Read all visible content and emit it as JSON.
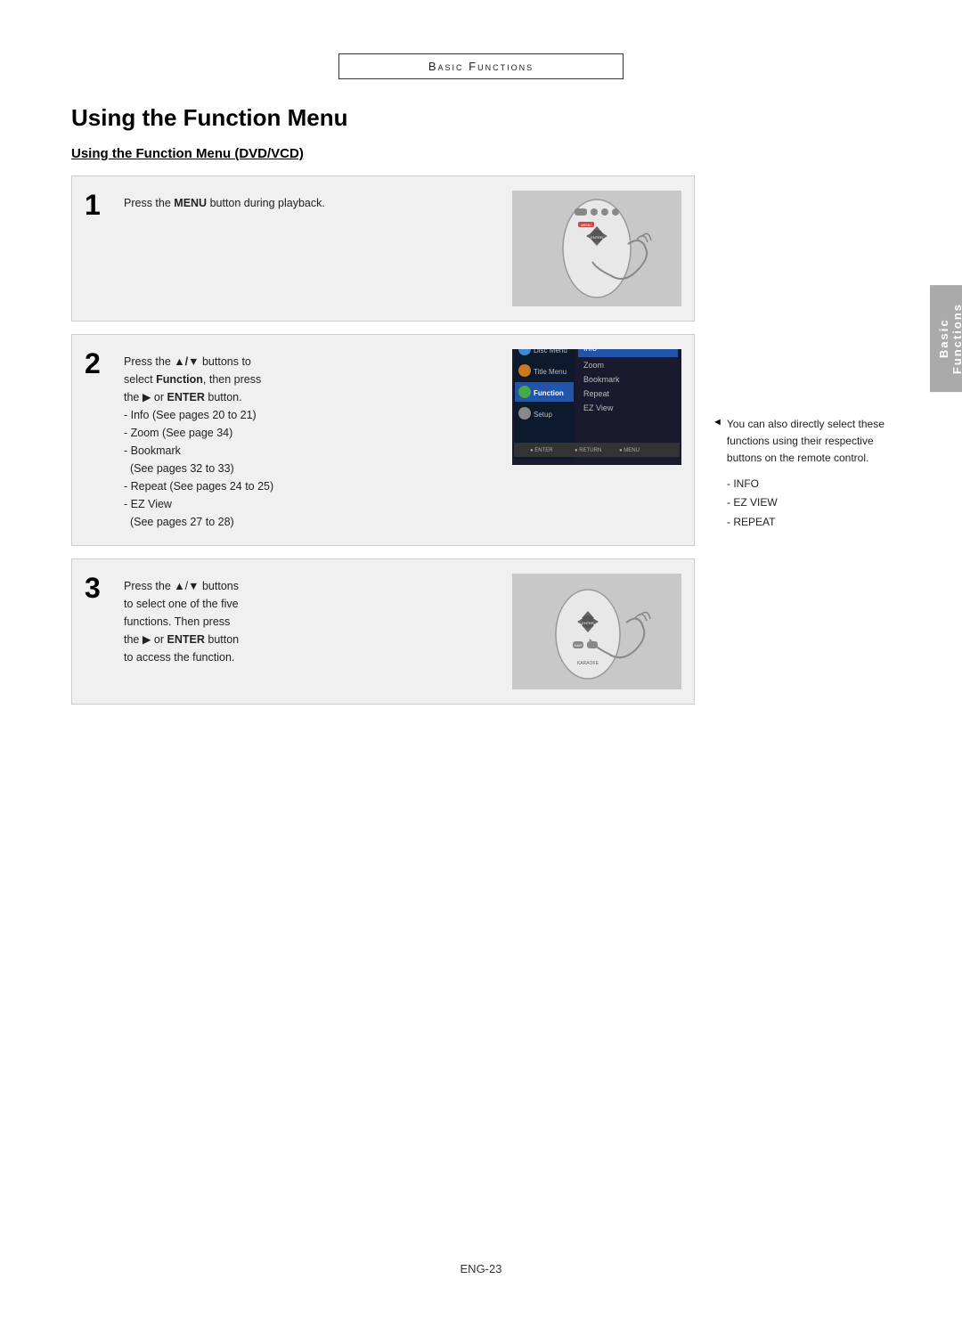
{
  "header": {
    "title": "Basic Functions"
  },
  "main_title": "Using the Function Menu",
  "section_heading": "Using the Function Menu (DVD/VCD)",
  "steps": [
    {
      "number": "1",
      "text_before_bold": "Press the ",
      "bold_text": "MENU",
      "text_after_bold": " button during playback.",
      "image_type": "remote_hand"
    },
    {
      "number": "2",
      "text_lines": [
        {
          "before": "Press the ",
          "bold": "▲/▼",
          "after": " buttons to"
        },
        {
          "before": "select ",
          "bold": "Function",
          "after": ", then press"
        },
        {
          "before": "the ▶ or ",
          "bold": "ENTER",
          "after": " button."
        },
        {
          "plain": "- Info (See pages 20 to 21)"
        },
        {
          "plain": "- Zoom (See page 34)"
        },
        {
          "plain": "- Bookmark"
        },
        {
          "plain": "  (See pages 32 to 33)"
        },
        {
          "plain": "- Repeat (See pages 24 to 25)"
        },
        {
          "plain": "- EZ View"
        },
        {
          "plain": "  (See pages 27 to 28)"
        }
      ],
      "image_type": "menu_screen",
      "menu_items": [
        "Info",
        "Zoom",
        "Bookmark",
        "Repeat",
        "EZ View"
      ],
      "menu_highlighted": "Info",
      "menu_sidebar": [
        "Disc Menu",
        "Title Menu",
        "Function",
        "Setup"
      ]
    },
    {
      "number": "3",
      "text_lines": [
        {
          "plain": "Press the ▲/▼ buttons"
        },
        {
          "plain": "to select one of the five"
        },
        {
          "plain": "functions. Then press"
        },
        {
          "before": "the ▶ or ",
          "bold": "ENTER",
          "after": " button"
        },
        {
          "plain": "to access the function."
        }
      ],
      "image_type": "remote_hand2"
    }
  ],
  "side_tab": {
    "line1": "Basic",
    "line2": "Functions"
  },
  "notes": {
    "bullet": "◄",
    "text": "You can also directly select these functions using their respective buttons on the remote control.",
    "items": [
      "- INFO",
      "- EZ VIEW",
      "- REPEAT"
    ]
  },
  "page_number": "ENG-23"
}
